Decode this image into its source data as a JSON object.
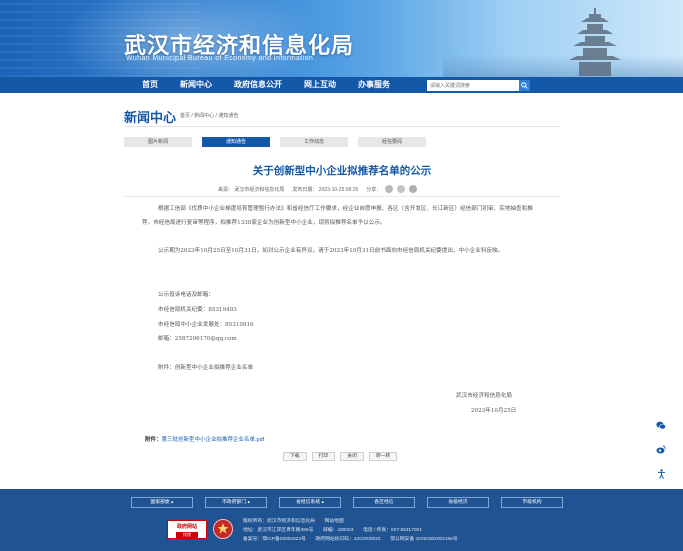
{
  "header": {
    "site_title": "武汉市经济和信息化局",
    "site_subtitle": "Wuhan Municipal Bureau of Economy and Information"
  },
  "nav": {
    "items": [
      "首页",
      "新闻中心",
      "政府信息公开",
      "网上互动",
      "办事服务"
    ],
    "search_placeholder": "请输入关键词搜索",
    "search_icon": "search-icon"
  },
  "section": {
    "title": "新闻中心",
    "breadcrumb": "首页 / 新闻中心 / 通知通告"
  },
  "tabs": [
    {
      "label": "图片新闻",
      "active": false
    },
    {
      "label": "通知通告",
      "active": true
    },
    {
      "label": "工作动态",
      "active": false
    },
    {
      "label": "经信要闻",
      "active": false
    }
  ],
  "article": {
    "title": "关于创新型中小企业拟推荐名单的公示",
    "source": "来源： 武汉市经济和信息化局",
    "date": "发布日期： 2023-10-25 09:25",
    "share_label": "分享：",
    "share_icons": [
      "wechat-icon",
      "weibo-icon",
      "qq-icon"
    ],
    "paragraph1": "根据工信部《优质中小企业梯度培育管理暂行办法》和省经信厅工作要求，经企业自愿申报、各区（含开发区、长江新区）经信部门初审、实地抽查和推荐，市经信局进行复审等程序，拟推荐1338家企业为创新型中小企业，现将拟推荐名单予以公示。",
    "paragraph2": "公示期为2023年10月25日至10月31日，如对公示企业有异议，请于2023年10月31日前书面向市经信局机关纪委提出，中小企业科反映。",
    "contact_title": "公示投诉电话及邮箱：",
    "contact_1": "市经信局机关纪委：85319493",
    "contact_2": "市经信局中小企业发展处：85310916",
    "contact_3": "邮箱：2587206170@qq.com",
    "attachment_line": "附件：创新型中小企业拟推荐企业名单",
    "sign_org": "武汉市经济和信息化局",
    "sign_date": "2023年10月25日",
    "attachment_label": "附件：",
    "attachment_link": "第三批创新型中小企业拟推荐企业名单.pdf"
  },
  "actions": [
    "下载",
    "打印",
    "关闭",
    "转一转"
  ],
  "side_icons": [
    "wechat-icon",
    "weibo-icon",
    "accessibility-icon"
  ],
  "footer": {
    "links": [
      "国家部委",
      "市政府部门",
      "省经信系统",
      "各区经信",
      "省级经济",
      "市级机构"
    ],
    "logo1_text": "政府网站",
    "logo1_sub": "找错",
    "info_line1": "版权所有：武汉市经济和信息化局　　网站地图",
    "info_line2": "地址：武汉市江岸区青年路366号　　邮编：430023　　电话 / 传真：027-85317001",
    "info_line3": "备案号：鄂ICP备20001623号　　政府网站标识码：4201000022　　鄂公网安备 42010302002168号"
  },
  "colors": {
    "primary": "#1458a8",
    "footer": "#1f5392",
    "tab_active": "#1458a8"
  }
}
